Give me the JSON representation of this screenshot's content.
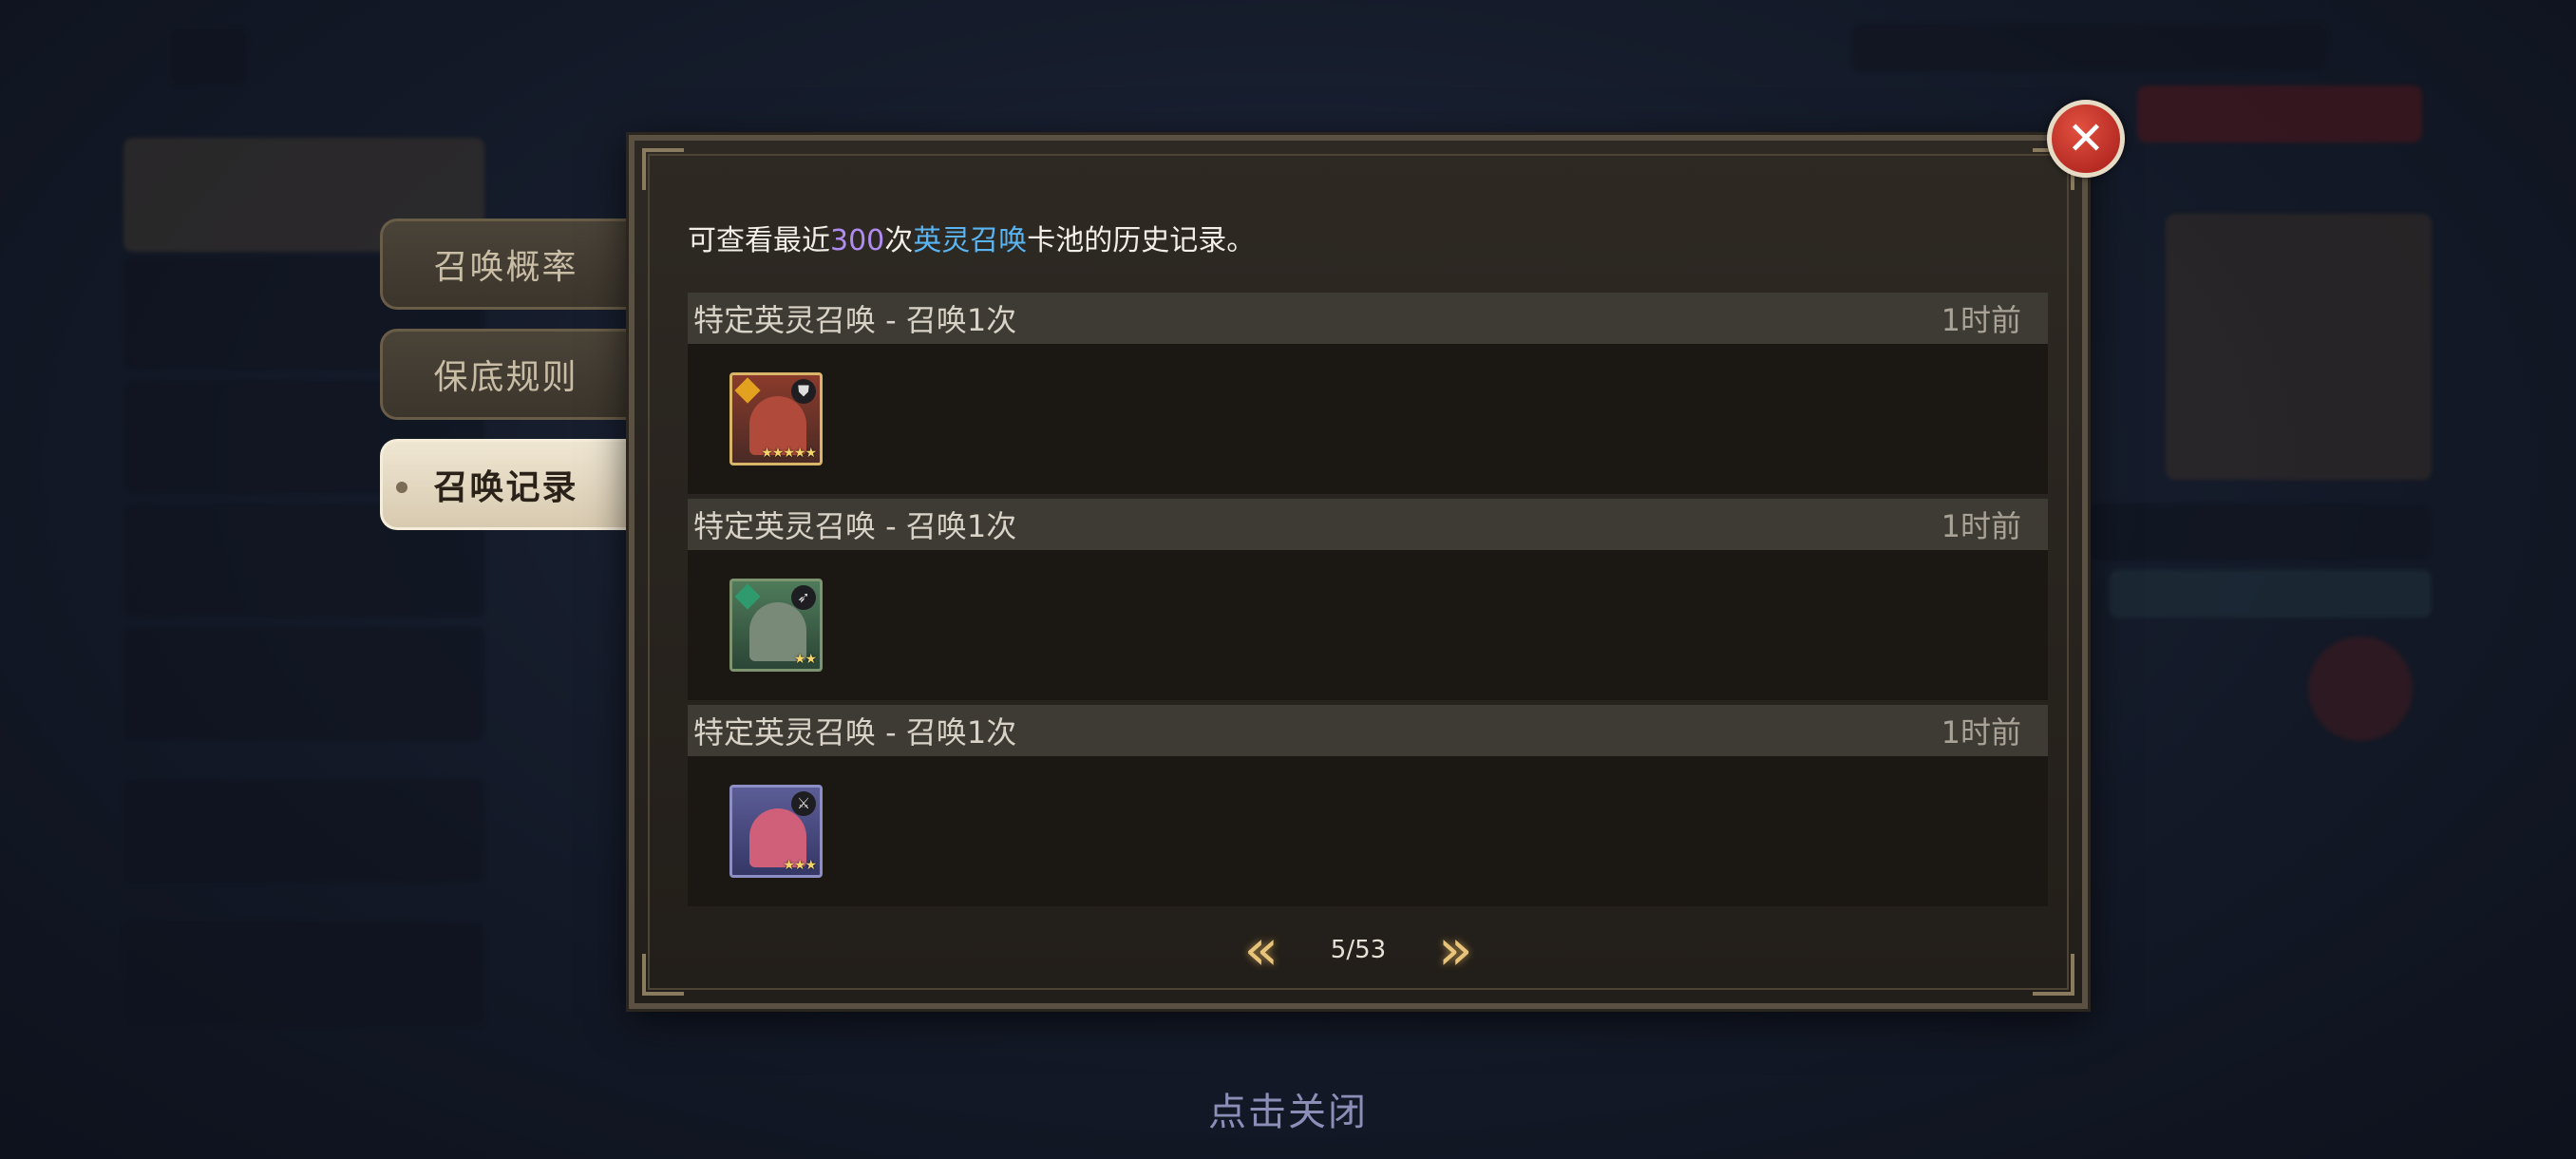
{
  "side_tabs": [
    {
      "label": "召唤概率",
      "active": false
    },
    {
      "label": "保底规则",
      "active": false
    },
    {
      "label": "召唤记录",
      "active": true
    }
  ],
  "intro": {
    "prefix": "可查看最近",
    "count": "300",
    "mid": "次",
    "pool": "英灵召唤",
    "suffix": "卡池的历史记录。"
  },
  "records": [
    {
      "title": "特定英灵召唤 - 召唤1次",
      "time": "1时前",
      "hero": {
        "rarity_stars": "★★★★★",
        "element_icon": "fire-element-icon",
        "class_icon": "shield-class-icon",
        "frame_color": "#d9b56a"
      }
    },
    {
      "title": "特定英灵召唤 - 召唤1次",
      "time": "1时前",
      "hero": {
        "rarity_stars": "★★",
        "element_icon": "wind-element-icon",
        "class_icon": "bow-class-icon",
        "frame_color": "#7e9470"
      }
    },
    {
      "title": "特定英灵召唤 - 召唤1次",
      "time": "1时前",
      "hero": {
        "rarity_stars": "★★★",
        "element_icon": "none",
        "class_icon": "blade-class-icon",
        "frame_color": "#8c8ec4"
      }
    }
  ],
  "pager": {
    "prev_icon": "double-chevron-left-icon",
    "page": "5/53",
    "next_icon": "double-chevron-right-icon"
  },
  "close_hint": "点击关闭"
}
